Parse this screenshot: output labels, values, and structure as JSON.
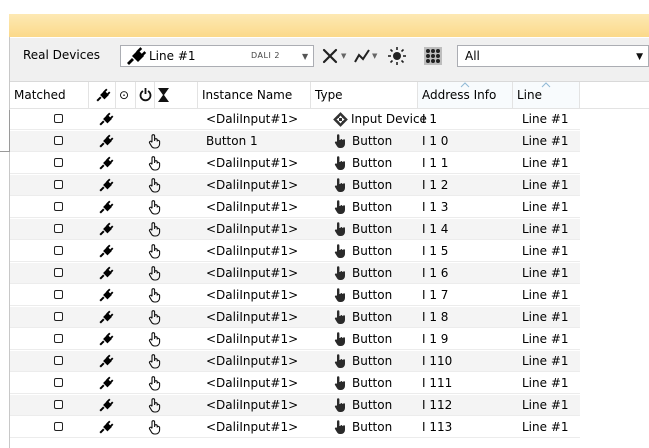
{
  "toolbar": {
    "real_devices_label": "Real Devices",
    "line_combo_value": "Line #1",
    "line_combo_sub": "DALI 2",
    "filter_combo_value": "All"
  },
  "columns": [
    "Matched",
    "",
    "",
    "",
    "",
    "Instance Name",
    "Type",
    "Address Info",
    "Line"
  ],
  "sorted_columns": [
    "Address Info",
    "Line"
  ],
  "rows": [
    {
      "name": "<DaliInput#1>",
      "type": "Input Device",
      "type_icon": "input-device-icon",
      "address": "I 1",
      "line": "Line #1",
      "has_hand": false
    },
    {
      "name": "Button 1",
      "type": "Button",
      "type_icon": "button-icon",
      "address": "I 1 0",
      "line": "Line #1",
      "has_hand": true
    },
    {
      "name": "<DaliInput#1>",
      "type": "Button",
      "type_icon": "button-icon",
      "address": "I 1 1",
      "line": "Line #1",
      "has_hand": true
    },
    {
      "name": "<DaliInput#1>",
      "type": "Button",
      "type_icon": "button-icon",
      "address": "I 1 2",
      "line": "Line #1",
      "has_hand": true
    },
    {
      "name": "<DaliInput#1>",
      "type": "Button",
      "type_icon": "button-icon",
      "address": "I 1 3",
      "line": "Line #1",
      "has_hand": true
    },
    {
      "name": "<DaliInput#1>",
      "type": "Button",
      "type_icon": "button-icon",
      "address": "I 1 4",
      "line": "Line #1",
      "has_hand": true
    },
    {
      "name": "<DaliInput#1>",
      "type": "Button",
      "type_icon": "button-icon",
      "address": "I 1 5",
      "line": "Line #1",
      "has_hand": true
    },
    {
      "name": "<DaliInput#1>",
      "type": "Button",
      "type_icon": "button-icon",
      "address": "I 1 6",
      "line": "Line #1",
      "has_hand": true
    },
    {
      "name": "<DaliInput#1>",
      "type": "Button",
      "type_icon": "button-icon",
      "address": "I 1 7",
      "line": "Line #1",
      "has_hand": true
    },
    {
      "name": "<DaliInput#1>",
      "type": "Button",
      "type_icon": "button-icon",
      "address": "I 1 8",
      "line": "Line #1",
      "has_hand": true
    },
    {
      "name": "<DaliInput#1>",
      "type": "Button",
      "type_icon": "button-icon",
      "address": "I 1 9",
      "line": "Line #1",
      "has_hand": true
    },
    {
      "name": "<DaliInput#1>",
      "type": "Button",
      "type_icon": "button-icon",
      "address": "I 110",
      "line": "Line #1",
      "has_hand": true
    },
    {
      "name": "<DaliInput#1>",
      "type": "Button",
      "type_icon": "button-icon",
      "address": "I 111",
      "line": "Line #1",
      "has_hand": true
    },
    {
      "name": "<DaliInput#1>",
      "type": "Button",
      "type_icon": "button-icon",
      "address": "I 112",
      "line": "Line #1",
      "has_hand": true
    },
    {
      "name": "<DaliInput#1>",
      "type": "Button",
      "type_icon": "button-icon",
      "address": "I 113",
      "line": "Line #1",
      "has_hand": true
    }
  ],
  "colors": {
    "banner": "#fbd98a",
    "toolbar_bg": "#f0f0f0",
    "alt_row": "#f4f4f4"
  }
}
